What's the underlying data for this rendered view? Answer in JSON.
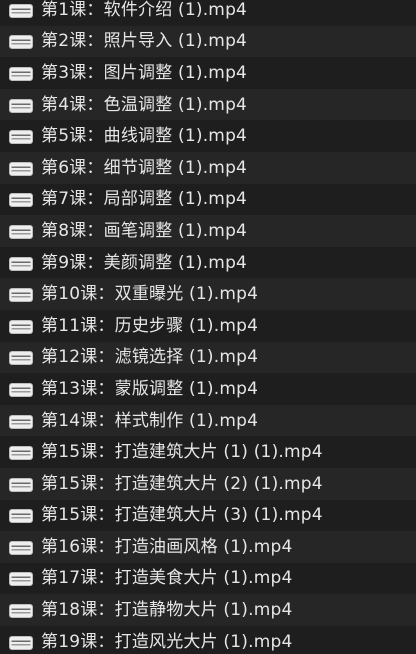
{
  "files": [
    {
      "name": "第1课：软件介绍 (1).mp4",
      "icon": "video-file-icon"
    },
    {
      "name": "第2课：照片导入 (1).mp4",
      "icon": "video-file-icon"
    },
    {
      "name": "第3课：图片调整 (1).mp4",
      "icon": "video-file-icon"
    },
    {
      "name": "第4课：色温调整 (1).mp4",
      "icon": "video-file-icon"
    },
    {
      "name": "第5课：曲线调整 (1).mp4",
      "icon": "video-file-icon"
    },
    {
      "name": "第6课：细节调整 (1).mp4",
      "icon": "video-file-icon"
    },
    {
      "name": "第7课：局部调整 (1).mp4",
      "icon": "video-file-icon"
    },
    {
      "name": "第8课：画笔调整 (1).mp4",
      "icon": "video-file-icon"
    },
    {
      "name": "第9课：美颜调整 (1).mp4",
      "icon": "video-file-icon"
    },
    {
      "name": "第10课：双重曝光 (1).mp4",
      "icon": "video-file-icon"
    },
    {
      "name": "第11课：历史步骤 (1).mp4",
      "icon": "video-file-icon"
    },
    {
      "name": "第12课：滤镜选择 (1).mp4",
      "icon": "video-file-icon"
    },
    {
      "name": "第13课：蒙版调整 (1).mp4",
      "icon": "video-file-icon"
    },
    {
      "name": "第14课：样式制作 (1).mp4",
      "icon": "video-file-icon"
    },
    {
      "name": "第15课：打造建筑大片 (1) (1).mp4",
      "icon": "video-file-icon"
    },
    {
      "name": "第15课：打造建筑大片 (2) (1).mp4",
      "icon": "video-file-icon"
    },
    {
      "name": "第15课：打造建筑大片 (3) (1).mp4",
      "icon": "video-file-icon"
    },
    {
      "name": "第16课：打造油画风格 (1).mp4",
      "icon": "video-file-icon"
    },
    {
      "name": "第17课：打造美食大片 (1).mp4",
      "icon": "video-file-icon"
    },
    {
      "name": "第18课：打造静物大片 (1).mp4",
      "icon": "video-file-icon"
    },
    {
      "name": "第19课：打造风光大片 (1).mp4",
      "icon": "video-file-icon"
    }
  ]
}
